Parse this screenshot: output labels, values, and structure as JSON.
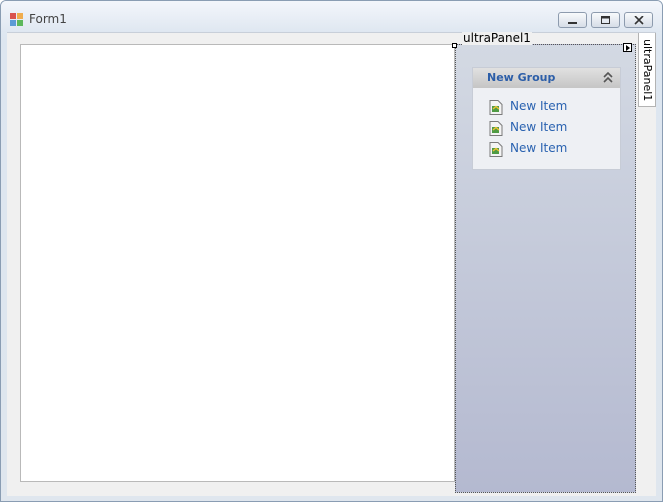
{
  "window": {
    "title": "Form1",
    "icon": "form-app-icon",
    "controls": [
      "minimize-icon",
      "maximize-icon",
      "close-icon"
    ]
  },
  "panel": {
    "caption": "ultraPanel1",
    "side_tab_label": "ultraPanel1"
  },
  "group": {
    "title": "New Group",
    "collapse_icon": "double-chevron-up-icon",
    "items": [
      {
        "label": "New Item"
      },
      {
        "label": "New Item"
      },
      {
        "label": "New Item"
      }
    ]
  },
  "colors": {
    "group_title": "#2c5ea8",
    "item_text": "#2a62b0",
    "panel_top": "#d3d9e3",
    "panel_bottom": "#b4b9d0"
  }
}
